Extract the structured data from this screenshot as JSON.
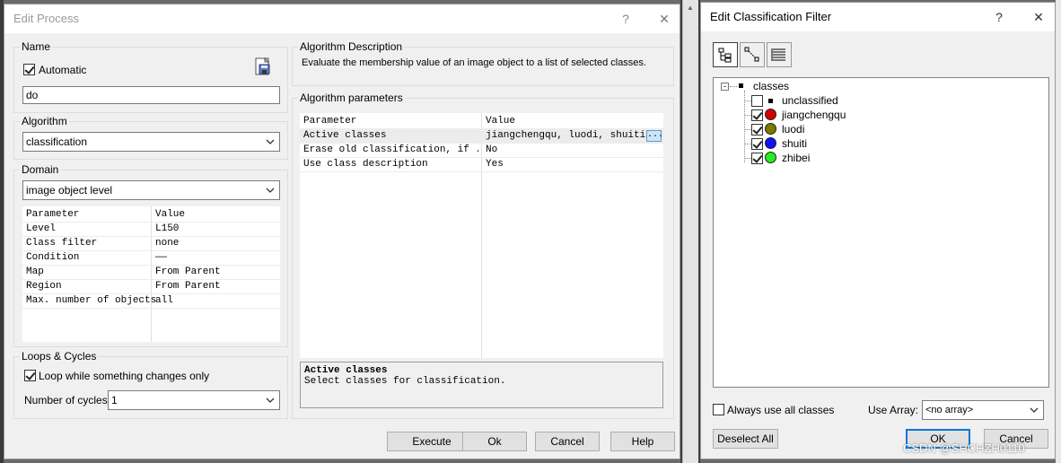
{
  "edit_process": {
    "title": "Edit Process",
    "help_icon": "?",
    "close_icon": "✕",
    "name_group": {
      "label": "Name",
      "automatic_label": "Automatic",
      "automatic_checked": true,
      "name_value": "do"
    },
    "algorithm_group": {
      "label": "Algorithm",
      "selected": "classification"
    },
    "domain_group": {
      "label": "Domain",
      "selected": "image object level",
      "header": {
        "param": "Parameter",
        "value": "Value"
      },
      "rows": [
        {
          "param": "Level",
          "value": "L150"
        },
        {
          "param": "Class filter",
          "value": "none"
        },
        {
          "param": "Condition",
          "value": "——"
        },
        {
          "param": "Map",
          "value": "From Parent"
        },
        {
          "param": "Region",
          "value": "From Parent"
        },
        {
          "param": "Max. number of objects",
          "value": "all"
        }
      ]
    },
    "loops_group": {
      "label": "Loops & Cycles",
      "loop_label": "Loop while something changes only",
      "loop_checked": true,
      "cycles_label": "Number of cycles",
      "cycles_value": "1"
    },
    "algo_desc": {
      "label": "Algorithm Description",
      "text": "Evaluate the membership value of an image object to a list of selected classes."
    },
    "algo_params": {
      "label": "Algorithm parameters",
      "header": {
        "param": "Parameter",
        "value": "Value"
      },
      "rows": [
        {
          "param": "Active classes",
          "value": "jiangchengqu, luodi, shuiti, ..."
        },
        {
          "param": "Erase old classification, if ...",
          "value": "No"
        },
        {
          "param": "Use class description",
          "value": "Yes"
        }
      ],
      "ellipsis_button": "...",
      "info_title": "Active classes",
      "info_text": "Select classes for classification."
    },
    "buttons": {
      "execute": "Execute",
      "ok": "Ok",
      "cancel": "Cancel",
      "help": "Help"
    }
  },
  "edit_filter": {
    "title": "Edit Classification Filter",
    "help_icon": "?",
    "close_icon": "✕",
    "tree": {
      "root_label": "classes",
      "items": [
        {
          "label": "unclassified",
          "checked": false,
          "color": ""
        },
        {
          "label": "jiangchengqu",
          "checked": true,
          "color": "#d40000"
        },
        {
          "label": "luodi",
          "checked": true,
          "color": "#7a7a00"
        },
        {
          "label": "shuiti",
          "checked": true,
          "color": "#1010ff"
        },
        {
          "label": "zhibei",
          "checked": true,
          "color": "#22ee22"
        }
      ]
    },
    "always_use_label": "Always use all classes",
    "always_use_checked": false,
    "use_array_label": "Use Array:",
    "use_array_value": "<no array>",
    "buttons": {
      "deselect_all": "Deselect All",
      "ok": "OK",
      "cancel": "Cancel"
    }
  },
  "watermark": "CSDN @SHCHZH0110"
}
